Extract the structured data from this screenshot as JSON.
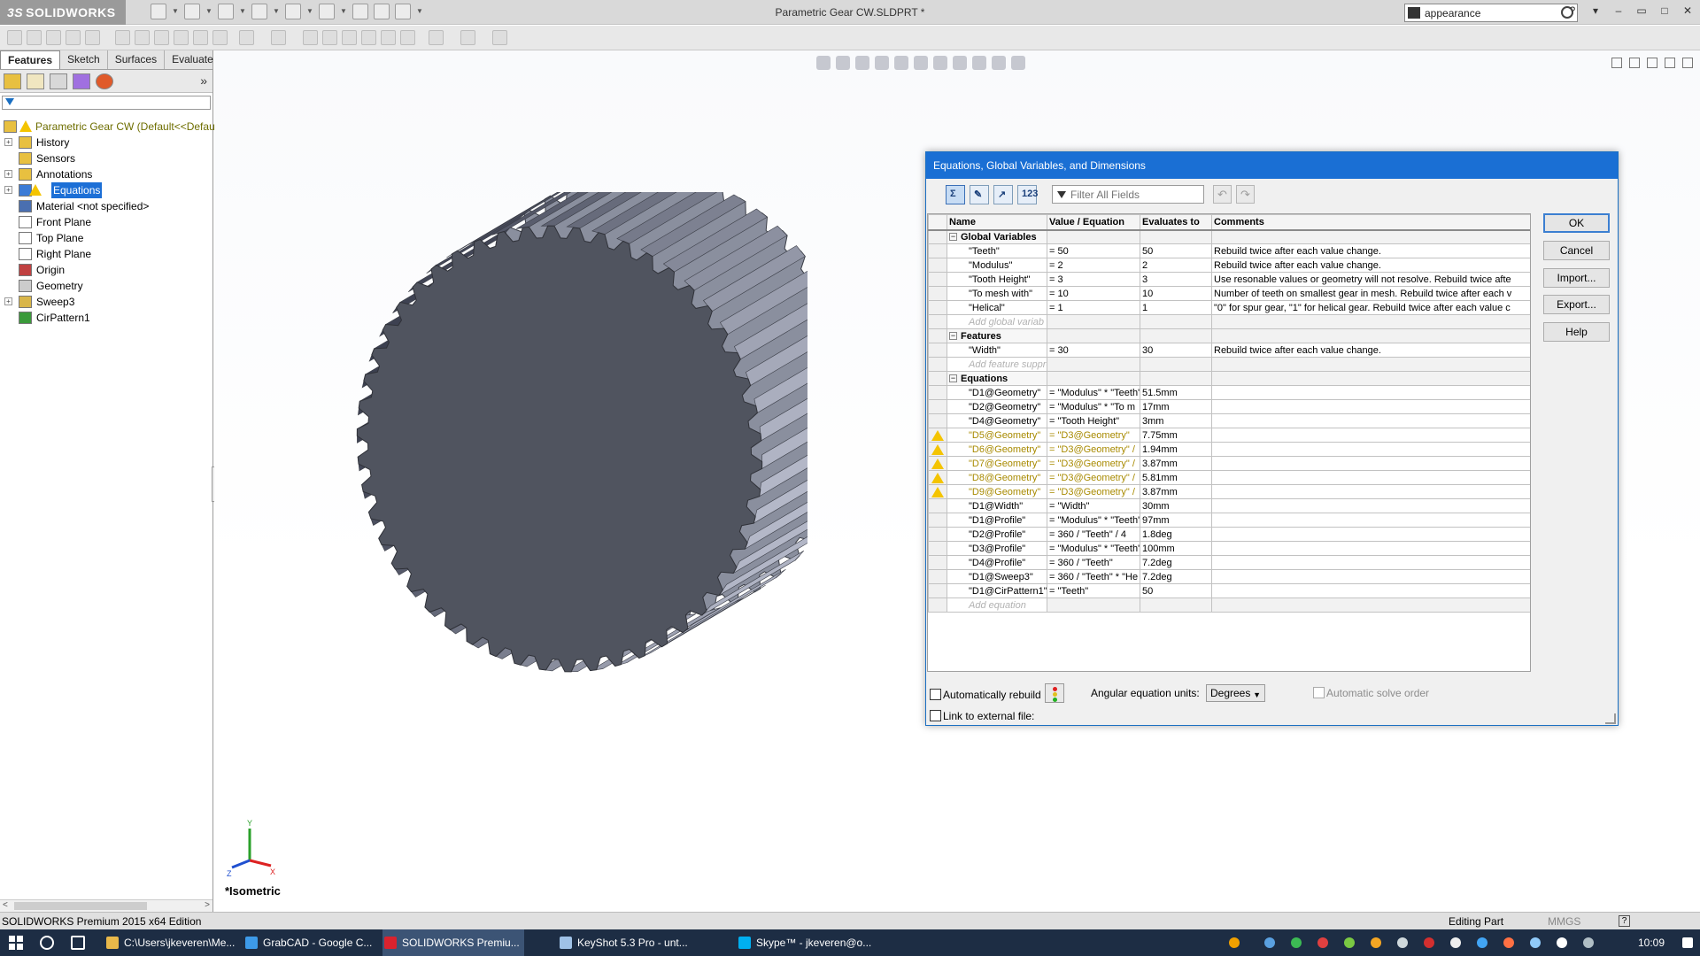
{
  "app": {
    "logo_text": "SOLIDWORKS",
    "logo_ds": "3S",
    "document_title": "Parametric Gear CW.SLDPRT *",
    "search_value": "appearance"
  },
  "feature_manager": {
    "tabs": [
      "Features",
      "Sketch",
      "Surfaces",
      "Evaluate"
    ],
    "tree": [
      {
        "label": "Parametric Gear CW  (Default<<Defau",
        "icon": "part-icon",
        "expand": false,
        "root": true
      },
      {
        "label": "History",
        "icon": "history-icon",
        "expand": true
      },
      {
        "label": "Sensors",
        "icon": "sensors-icon",
        "expand": false
      },
      {
        "label": "Annotations",
        "icon": "annotations-icon",
        "expand": true
      },
      {
        "label": "Equations",
        "icon": "equations-icon",
        "expand": true,
        "selected": true
      },
      {
        "label": "Material <not specified>",
        "icon": "material-icon",
        "expand": false
      },
      {
        "label": "Front Plane",
        "icon": "plane-icon",
        "expand": false
      },
      {
        "label": "Top Plane",
        "icon": "plane-icon",
        "expand": false
      },
      {
        "label": "Right Plane",
        "icon": "plane-icon",
        "expand": false
      },
      {
        "label": "Origin",
        "icon": "origin-icon",
        "expand": false
      },
      {
        "label": "Geometry",
        "icon": "sketch-icon",
        "expand": false
      },
      {
        "label": "Sweep3",
        "icon": "sweep-icon",
        "expand": true
      },
      {
        "label": "CirPattern1",
        "icon": "circular-pattern-icon",
        "expand": false
      }
    ]
  },
  "viewport": {
    "view_name": "*Isometric",
    "triad": {
      "x": "X",
      "y": "Y",
      "z": "Z"
    }
  },
  "dialog": {
    "title": "Equations, Global Variables, and Dimensions",
    "toolbar_icons": [
      "equation-view-icon",
      "sketch-equation-view-icon",
      "dimension-view-icon",
      "ordered-view-icon"
    ],
    "filter_placeholder": "Filter All Fields",
    "columns": [
      "Name",
      "Value / Equation",
      "Evaluates to",
      "Comments"
    ],
    "sections": [
      {
        "title": "Global Variables",
        "rows": [
          {
            "name": "\"Teeth\"",
            "value": "= 50",
            "evaluates": "50",
            "comment": "Rebuild twice after each value change."
          },
          {
            "name": "\"Modulus\"",
            "value": "= 2",
            "evaluates": "2",
            "comment": "Rebuild twice after each value change."
          },
          {
            "name": "\"Tooth Height\"",
            "value": "= 3",
            "evaluates": "3",
            "comment": "Use resonable values or geometry will not resolve. Rebuild twice afte"
          },
          {
            "name": "\"To mesh with\"",
            "value": "= 10",
            "evaluates": "10",
            "comment": "Number of teeth on smallest gear in mesh. Rebuild twice after each v"
          },
          {
            "name": "\"Helical\"",
            "value": "= 1",
            "evaluates": "1",
            "comment": "\"0\" for spur gear, \"1\" for helical gear. Rebuild twice after each value c"
          }
        ],
        "add_text": "Add global variab"
      },
      {
        "title": "Features",
        "rows": [
          {
            "name": "\"Width\"",
            "value": "= 30",
            "evaluates": "30",
            "comment": "Rebuild twice after each value change."
          }
        ],
        "add_text": "Add feature suppre"
      },
      {
        "title": "Equations",
        "rows": [
          {
            "name": "\"D1@Geometry\"",
            "value": "= \"Modulus\" * \"Teeth\"",
            "evaluates": "51.5mm",
            "comment": ""
          },
          {
            "name": "\"D2@Geometry\"",
            "value": "= \"Modulus\" * \"To m",
            "evaluates": "17mm",
            "comment": ""
          },
          {
            "name": "\"D4@Geometry\"",
            "value": "= \"Tooth Height\"",
            "evaluates": "3mm",
            "comment": ""
          },
          {
            "name": "\"D5@Geometry\"",
            "value": "= \"D3@Geometry\"",
            "evaluates": "7.75mm",
            "comment": "",
            "warning": true
          },
          {
            "name": "\"D6@Geometry\"",
            "value": "= \"D3@Geometry\" /",
            "evaluates": "1.94mm",
            "comment": "",
            "warning": true
          },
          {
            "name": "\"D7@Geometry\"",
            "value": "= \"D3@Geometry\" /",
            "evaluates": "3.87mm",
            "comment": "",
            "warning": true
          },
          {
            "name": "\"D8@Geometry\"",
            "value": "= \"D3@Geometry\" /",
            "evaluates": "5.81mm",
            "comment": "",
            "warning": true
          },
          {
            "name": "\"D9@Geometry\"",
            "value": "= \"D3@Geometry\" /",
            "evaluates": "3.87mm",
            "comment": "",
            "warning": true
          },
          {
            "name": "\"D1@Width\"",
            "value": "= \"Width\"",
            "evaluates": "30mm",
            "comment": ""
          },
          {
            "name": "\"D1@Profile\"",
            "value": "= \"Modulus\" * \"Teeth\"",
            "evaluates": "97mm",
            "comment": ""
          },
          {
            "name": "\"D2@Profile\"",
            "value": "= 360 / \"Teeth\" / 4",
            "evaluates": "1.8deg",
            "comment": ""
          },
          {
            "name": "\"D3@Profile\"",
            "value": "= \"Modulus\" * \"Teeth\"",
            "evaluates": "100mm",
            "comment": ""
          },
          {
            "name": "\"D4@Profile\"",
            "value": "= 360 / \"Teeth\"",
            "evaluates": "7.2deg",
            "comment": ""
          },
          {
            "name": "\"D1@Sweep3\"",
            "value": "= 360 / \"Teeth\" * \"He",
            "evaluates": "7.2deg",
            "comment": ""
          },
          {
            "name": "\"D1@CirPattern1\"",
            "value": "= \"Teeth\"",
            "evaluates": "50",
            "comment": ""
          }
        ],
        "add_text": "Add equation"
      }
    ],
    "buttons": {
      "ok": "OK",
      "cancel": "Cancel",
      "import": "Import...",
      "export": "Export...",
      "help": "Help"
    },
    "auto_rebuild_label": "Automatically rebuild",
    "angular_units_label": "Angular equation units:",
    "angular_units_value": "Degrees",
    "auto_solve_label": "Automatic solve order",
    "link_label": "Link to external file:"
  },
  "statusbar": {
    "left": "SOLIDWORKS Premium 2015 x64 Edition",
    "mode": "Editing Part",
    "units": "MMGS",
    "help": "?"
  },
  "taskbar": {
    "tasks": [
      {
        "label": "C:\\Users\\jkeveren\\Me...",
        "icon_color": "#e8b84a",
        "active": false
      },
      {
        "label": "GrabCAD - Google C...",
        "icon_color": "#3d9ae8",
        "active": false
      },
      {
        "label": "SOLIDWORKS Premiu...",
        "icon_color": "#d9232e",
        "active": true
      },
      {
        "label": "KeyShot 5.3 Pro - unt...",
        "icon_color": "#9fc1e6",
        "active": false
      },
      {
        "label": "Skype™ - jkeveren@o...",
        "icon_color": "#00aff0",
        "active": false
      }
    ],
    "clock": "10:09 PM"
  }
}
